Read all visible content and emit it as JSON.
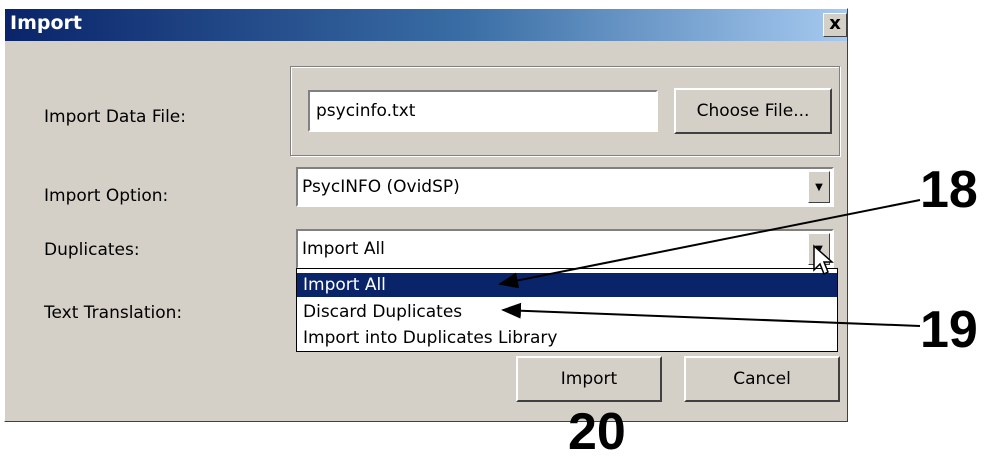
{
  "dialog": {
    "title": "Import",
    "close_glyph": "x"
  },
  "form": {
    "import_data_file": {
      "label": "Import Data File:",
      "value": "psycinfo.txt",
      "button": "Choose File..."
    },
    "import_option": {
      "label": "Import Option:",
      "value": "PsycINFO (OvidSP)"
    },
    "duplicates": {
      "label": "Duplicates:",
      "value": "Import All"
    },
    "text_translation": {
      "label": "Text Translation:"
    }
  },
  "duplicates_options": [
    "Import All",
    "Discard Duplicates",
    "Import into Duplicates Library"
  ],
  "buttons": {
    "import": "Import",
    "cancel": "Cancel"
  },
  "callouts": {
    "c18": "18",
    "c19": "19",
    "c20": "20"
  },
  "colors": {
    "title_start": "#0a246a",
    "title_end": "#a6caf0",
    "dialog_bg": "#d4d0c8",
    "selection": "#0a246a"
  }
}
